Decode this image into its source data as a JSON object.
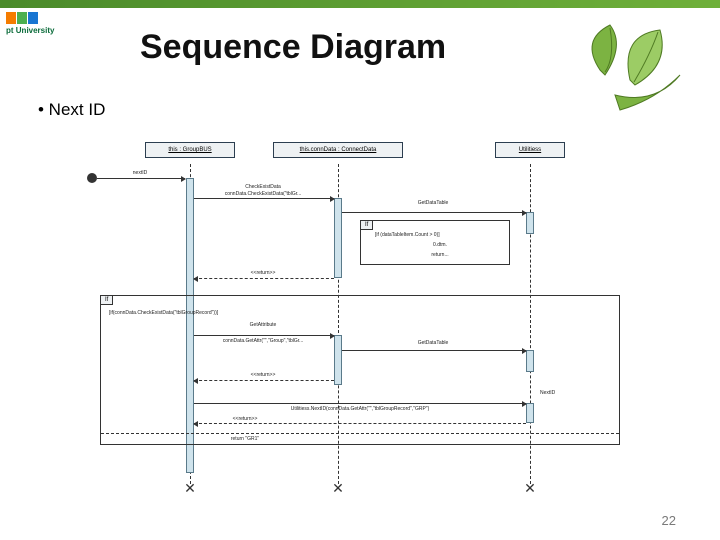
{
  "header": {
    "logo_text": "pt University"
  },
  "title": "Sequence Diagram",
  "bullet": "•  Next ID",
  "page_number": "22",
  "diagram": {
    "lifelines": {
      "a": "this : GroupBUS",
      "b": "this.connData : ConnectData",
      "c": "Utilitiess"
    },
    "msg": {
      "nextID": "nextID",
      "checkExistData": "CheckExistData",
      "checkExistDataCall": "connData.CheckExistData(\"tblGr...",
      "getDataTable1": "GetDataTable",
      "return1": "<<return>>",
      "guardIf": "[if (dataTableItem.Count > 0)]",
      "dtItem": "0.dtm.",
      "returnM": "return...",
      "conditionIf": "[if(connData.CheckExistData(\"tblGroupRecord\"))]",
      "getAttr": "GetAttribute",
      "connDataGetAttr": "connData.GetAttr(\"\",\"Group\",\"tblGr...",
      "getDataTable2": "GetDataTable",
      "return2": "<<return>>",
      "nextIDLabel": "NextID",
      "utilNextID": "Utilitiess.NextID(connData.GetAttr(\"\",\"tblGroupRecord\",\"GRP\")",
      "returnEnd": "<<return>>",
      "returnGR": "return \"GR1\"",
      "ifLabel": "If",
      "ifLabel2": "If"
    }
  }
}
